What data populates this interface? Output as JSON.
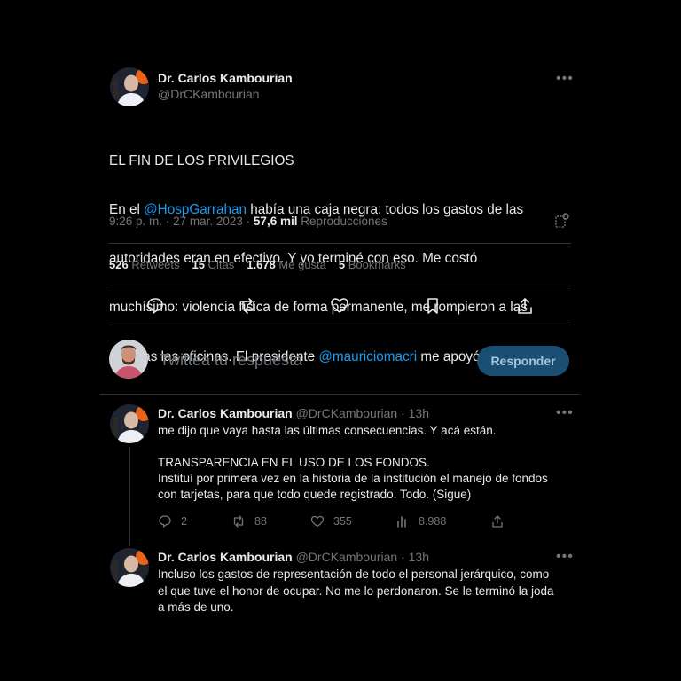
{
  "main_tweet": {
    "author_name": "Dr. Carlos Kambourian",
    "author_handle": "@DrCKambourian",
    "line1": "EL FIN DE LOS PRIVILEGIOS",
    "line2_pre": "En el ",
    "mention1": "@HospGarrahan",
    "line2_post": " había una caja negra: todos los gastos de las",
    "line3": "autoridades eran en efectivo. Y yo terminé con eso. Me costó",
    "line4": "muchísimo: violencia física de forma permanente, me rompieron a las",
    "line5_pre": "patadas las oficinas. El presidente ",
    "mention2": "@mauriciomacri",
    "line5_post": " me apoyó",
    "time": "9:26 p. m.",
    "date": "27 mar. 2023",
    "dot": "·",
    "views_count": "57,6 mil",
    "views_label": "Reproducciones",
    "stats": {
      "retweets_count": "526",
      "retweets_label": "Retweets",
      "quotes_count": "15",
      "quotes_label": "Citas",
      "likes_count": "1.678",
      "likes_label": "Me gusta",
      "bookmarks_count": "5",
      "bookmarks_label": "Bookmarks"
    }
  },
  "composer": {
    "placeholder": "Twittea tu respuesta",
    "button": "Responder"
  },
  "replies": [
    {
      "author_name": "Dr. Carlos Kambourian",
      "author_handle": "@DrCKambourian",
      "age": "13h",
      "sep": "·",
      "text": "me dijo que vaya hasta las últimas consecuencias. Y acá están.\n\nTRANSPARENCIA EN EL USO DE LOS FONDOS.\nInstituí por primera vez en la historia de la institución el manejo de fondos\ncon tarjetas, para que todo quede registrado. Todo. (Sigue)",
      "reply_count": "2",
      "retweet_count": "88",
      "like_count": "355",
      "view_count": "8.988"
    },
    {
      "author_name": "Dr. Carlos Kambourian",
      "author_handle": "@DrCKambourian",
      "age": "13h",
      "sep": "·",
      "text": "Incluso los gastos de representación de todo el personal jerárquico, como\nel que tuve el honor de ocupar. No me lo perdonaron. Se le terminó la joda\na más de uno."
    }
  ],
  "colors": {
    "background": "#000000",
    "text": "#e7e9ea",
    "muted": "#71767b",
    "link": "#1d9bf0",
    "divider": "#2f3336",
    "reply_button_bg": "#1a4f73"
  },
  "icons": {
    "more": "more-horizontal-icon",
    "reply": "reply-icon",
    "retweet": "retweet-icon",
    "like": "heart-icon",
    "bookmark": "bookmark-icon",
    "share": "share-icon",
    "views": "views-bar-icon",
    "analytics": "analytics-icon"
  }
}
